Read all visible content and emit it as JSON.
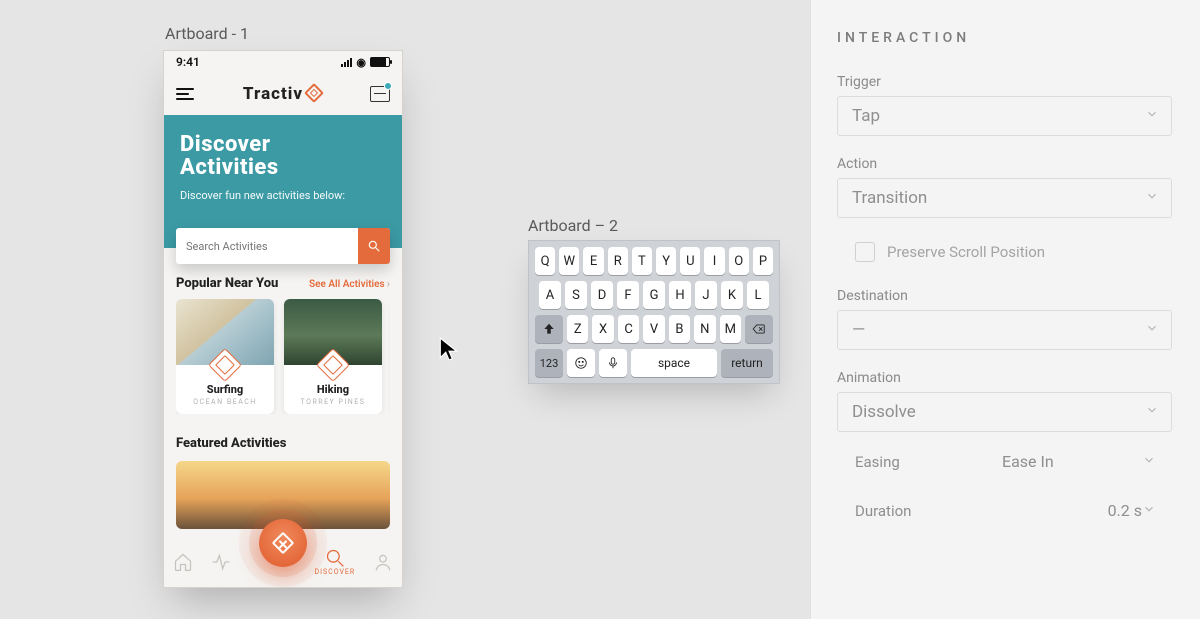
{
  "canvas": {
    "artboard1_label": "Artboard - 1",
    "artboard2_label": "Artboard – 2"
  },
  "phone": {
    "statusbar_time": "9:41",
    "brand": "Tractiv",
    "hero_title_line1": "Discover",
    "hero_title_line2": "Activities",
    "hero_sub": "Discover fun new activities below:",
    "search_placeholder": "Search Activities",
    "popular_heading": "Popular Near You",
    "see_all": "See All Activities",
    "cards": [
      {
        "title": "Surfing",
        "sub": "OCEAN BEACH"
      },
      {
        "title": "Hiking",
        "sub": "TORREY PINES"
      }
    ],
    "featured_heading": "Featured Activities",
    "tab_discover": "DISCOVER"
  },
  "keyboard": {
    "row1": [
      "Q",
      "W",
      "E",
      "R",
      "T",
      "Y",
      "U",
      "I",
      "O",
      "P"
    ],
    "row2": [
      "A",
      "S",
      "D",
      "F",
      "G",
      "H",
      "J",
      "K",
      "L"
    ],
    "row3": [
      "Z",
      "X",
      "C",
      "V",
      "B",
      "N",
      "M"
    ],
    "num_key": "123",
    "space_key": "space",
    "return_key": "return"
  },
  "sidebar": {
    "heading": "INTERACTION",
    "trigger_label": "Trigger",
    "trigger_value": "Tap",
    "action_label": "Action",
    "action_value": "Transition",
    "preserve_scroll": "Preserve Scroll Position",
    "destination_label": "Destination",
    "destination_value": "—",
    "animation_label": "Animation",
    "animation_value": "Dissolve",
    "easing_label": "Easing",
    "easing_value": "Ease In",
    "duration_label": "Duration",
    "duration_value": "0.2 s"
  }
}
